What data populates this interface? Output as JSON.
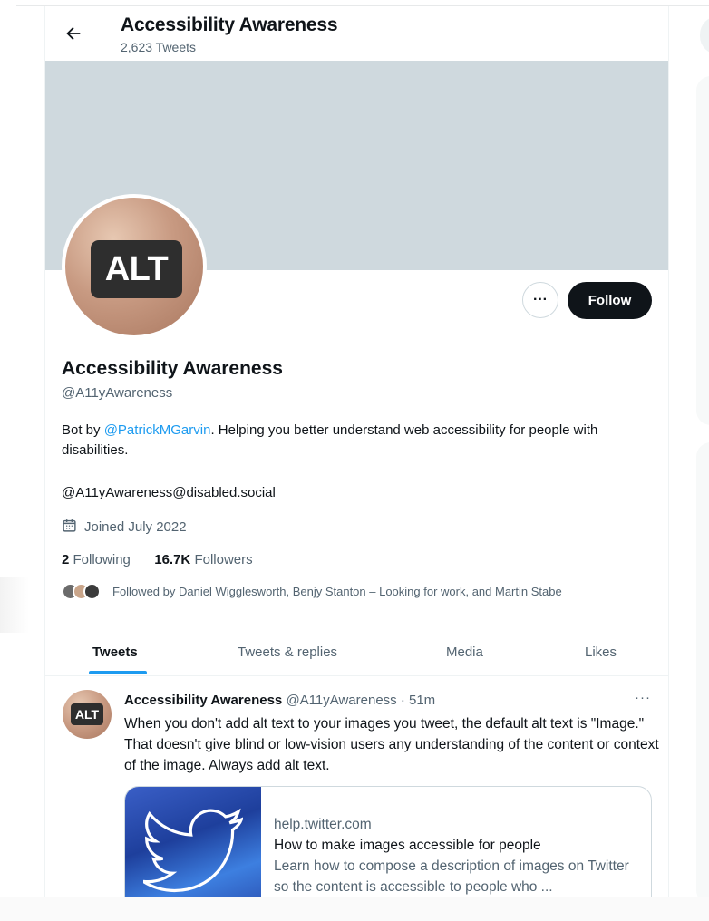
{
  "header": {
    "title": "Accessibility Awareness",
    "tweet_count": "2,623 Tweets"
  },
  "profile": {
    "avatar_text": "ALT",
    "name": "Accessibility Awareness",
    "handle": "@A11yAwareness",
    "bio_prefix": "Bot by ",
    "bio_link": "@PatrickMGarvin",
    "bio_suffix": ". Helping you better understand web accessibility for people with disabilities.",
    "extra": "@A11yAwareness@disabled.social",
    "joined": "Joined July 2022",
    "following_count": "2",
    "following_label": "Following",
    "followers_count": "16.7K",
    "followers_label": "Followers",
    "followed_by": "Followed by Daniel Wigglesworth, Benjy Stanton – Looking for work, and Martin Stabe",
    "follow_label": "Follow",
    "more_label": "···"
  },
  "tabs": [
    {
      "label": "Tweets",
      "active": true
    },
    {
      "label": "Tweets & replies",
      "active": false
    },
    {
      "label": "Media",
      "active": false
    },
    {
      "label": "Likes",
      "active": false
    }
  ],
  "tweet": {
    "avatar_text": "ALT",
    "author": "Accessibility Awareness",
    "handle_time": "@A11yAwareness · 51m",
    "more": "···",
    "text": "When you don't add alt text to your images you tweet, the default alt text is \"Image.\" That doesn't give blind or low-vision users any understanding of the content or context of the image. Always add alt text.",
    "card": {
      "domain": "help.twitter.com",
      "title": "How to make images accessible for people",
      "description": "Learn how to compose a description of images on Twitter so the content is accessible to people who ..."
    }
  },
  "colors": {
    "accent": "#1d9bf0",
    "banner": "#cfd9de",
    "text": "#0f1419",
    "secondary": "#536471"
  }
}
